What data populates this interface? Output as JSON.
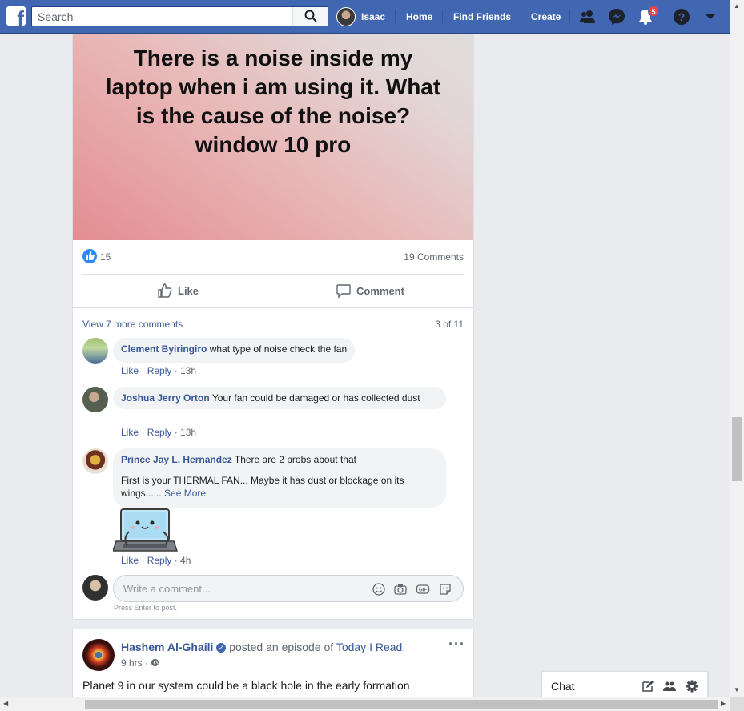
{
  "topbar": {
    "search_placeholder": "Search",
    "user_name": "Isaac",
    "nav": [
      "Home",
      "Find Friends",
      "Create"
    ],
    "notification_count": "5",
    "brand_color": "#4267b2"
  },
  "post": {
    "text": "There is a noise inside my laptop when i am using it. What is the cause of the noise?window 10 pro",
    "like_count": "15",
    "comments_count": "19 Comments",
    "actions": {
      "like": "Like",
      "comment": "Comment"
    },
    "view_more": "View 7 more comments",
    "pager": "3 of 11",
    "comments": [
      {
        "author": "Clement Byiringiro",
        "text": "what type of noise check the fan",
        "like": "Like",
        "reply": "Reply",
        "time": "13h"
      },
      {
        "author": "Joshua Jerry Orton",
        "text": "Your fan could be damaged or has collected dust",
        "like": "Like",
        "reply": "Reply",
        "time": "13h"
      },
      {
        "author": "Prince Jay L. Hernandez",
        "text": "There are 2 probs about that",
        "text2": "First is your THERMAL FAN... Maybe it has dust or blockage on its wings......",
        "see_more": "See More",
        "like": "Like",
        "reply": "Reply",
        "time": "4h"
      }
    ],
    "composer_placeholder": "Write a comment...",
    "press_enter": "Press Enter to post."
  },
  "post2": {
    "author": "Hashem Al-Ghaili",
    "action": "posted an episode of",
    "page": "Today I Read.",
    "time": "9 hrs",
    "text": "Planet 9 in our system could be a black hole in the early formation"
  },
  "chat": {
    "label": "Chat"
  }
}
